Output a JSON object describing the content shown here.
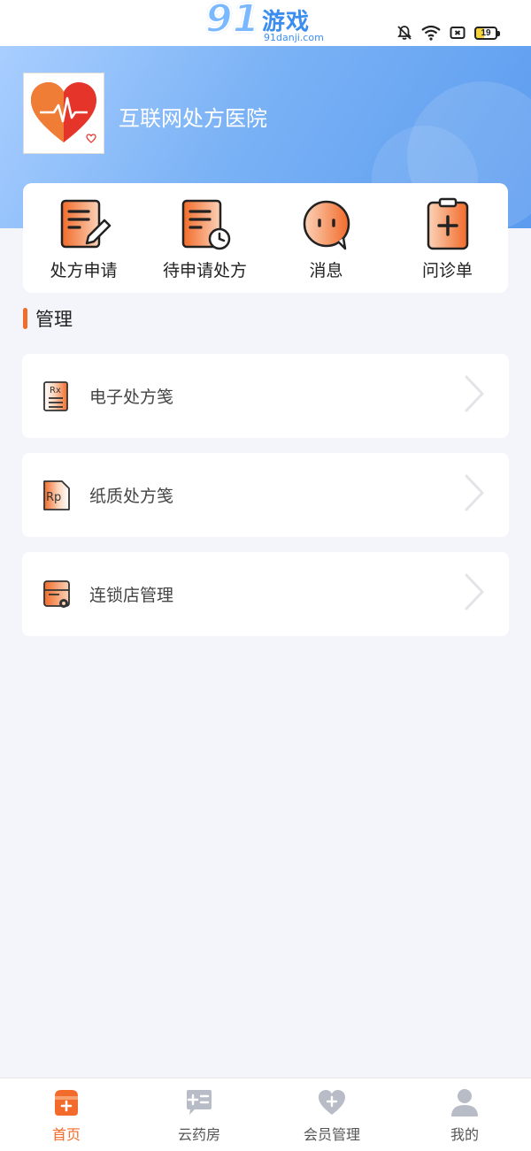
{
  "watermark": {
    "big": "91",
    "title": "游戏",
    "url": "91danji.com"
  },
  "status_bar": {
    "battery": "19",
    "icons": [
      "bell-off-icon",
      "wifi-icon",
      "sim-icon",
      "battery-icon"
    ]
  },
  "header": {
    "hospital_name": "互联网处方医院",
    "logo_icon": "heart-pulse-icon"
  },
  "quick_actions": [
    {
      "label": "处方申请",
      "icon": "prescription-edit-icon"
    },
    {
      "label": "待申请处方",
      "icon": "prescription-pending-icon"
    },
    {
      "label": "消息",
      "icon": "message-icon"
    },
    {
      "label": "问诊单",
      "icon": "consultation-form-icon"
    }
  ],
  "section": {
    "title": "管理"
  },
  "management_items": [
    {
      "label": "电子处方笺",
      "icon": "rx-document-icon"
    },
    {
      "label": "纸质处方笺",
      "icon": "rp-paper-icon"
    },
    {
      "label": "连锁店管理",
      "icon": "store-settings-icon"
    }
  ],
  "bottom_nav": [
    {
      "label": "首页",
      "icon": "home-icon",
      "active": true
    },
    {
      "label": "云药房",
      "icon": "cloud-pharmacy-icon",
      "active": false
    },
    {
      "label": "会员管理",
      "icon": "member-heart-icon",
      "active": false
    },
    {
      "label": "我的",
      "icon": "user-icon",
      "active": false
    }
  ],
  "colors": {
    "accent": "#f26b2a",
    "header_blue": "#7ab2f5",
    "background": "#f3f5fb"
  }
}
